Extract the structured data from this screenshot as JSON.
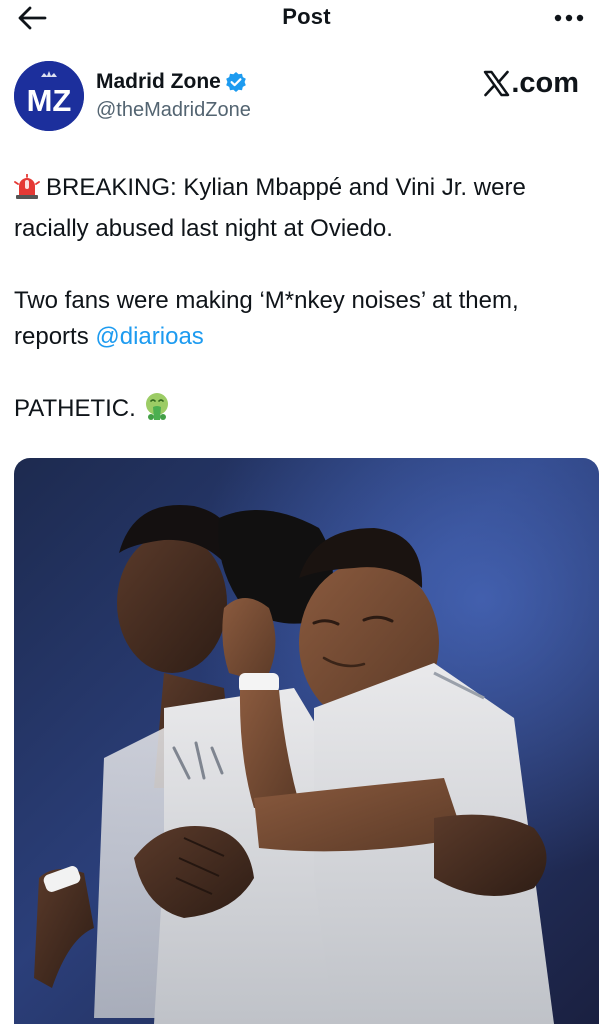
{
  "header": {
    "title": "Post",
    "back_icon": "arrow-left-icon",
    "more_icon": "more-horizontal-icon"
  },
  "author": {
    "avatar_text": "MZ",
    "name": "Madrid Zone",
    "handle": "@theMadridZone",
    "verified": true,
    "avatar_color": "#1c2f9c",
    "verified_color": "#1d9bf0"
  },
  "watermark": {
    "text": ".com",
    "logo_letter": "X"
  },
  "tweet": {
    "line1_emoji": "police-car-light-emoji",
    "line1": "BREAKING: Kylian Mbappé and Vini Jr. were racially abused last night at Oviedo.",
    "line2_text": "Two fans were making ‘M*nkey noises’ at them, reports ",
    "line2_mention": "@diarioas",
    "line3_text": "PATHETIC.",
    "line3_emoji": "face-vomiting-emoji"
  },
  "media": {
    "kind": "photo",
    "accent_color": "#1d9bf0"
  }
}
